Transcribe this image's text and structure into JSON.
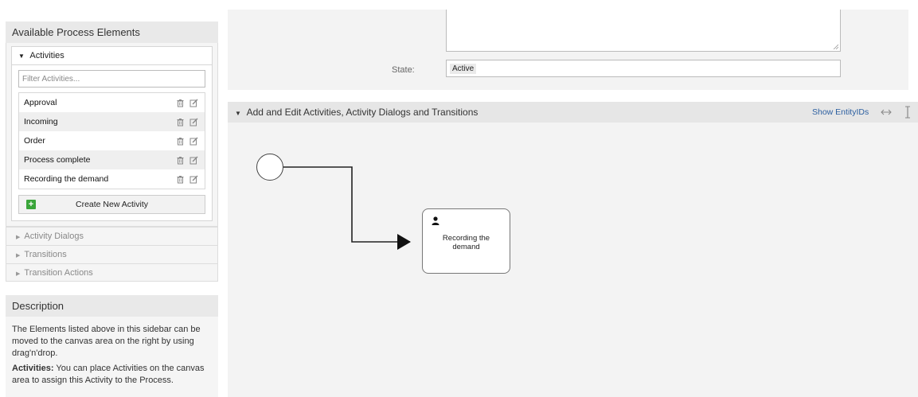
{
  "sidebar": {
    "available_title": "Available Process Elements",
    "activities_header": "Activities",
    "filter_placeholder": "Filter Activities...",
    "activities": [
      {
        "label": "Approval"
      },
      {
        "label": "Incoming"
      },
      {
        "label": "Order"
      },
      {
        "label": "Process complete"
      },
      {
        "label": "Recording the demand"
      }
    ],
    "create_button": "Create New Activity",
    "collapsed_sections": [
      "Activity Dialogs",
      "Transitions",
      "Transition Actions"
    ]
  },
  "description": {
    "title": "Description",
    "para1": "The Elements listed above in this sidebar can be moved to the canvas area on the right by using drag'n'drop.",
    "para2_bold": "Activities:",
    "para2_text": " You can place Activities on the canvas area to assign this Activity to the Process."
  },
  "form": {
    "state_label": "State:",
    "state_value": "Active"
  },
  "canvas_panel": {
    "title": "Add and Edit Activities, Activity Dialogs and Transitions",
    "show_entity_ids": "Show EntityIDs",
    "activity_node_label": "Recording the demand"
  },
  "colors": {
    "accent_green": "#3aa53a",
    "link_blue": "#2c5fa0",
    "panel_bg": "#f3f3f3"
  },
  "icons": {
    "delete": "trash-icon",
    "edit": "edit-icon",
    "add": "plus-icon",
    "user": "user-icon"
  }
}
